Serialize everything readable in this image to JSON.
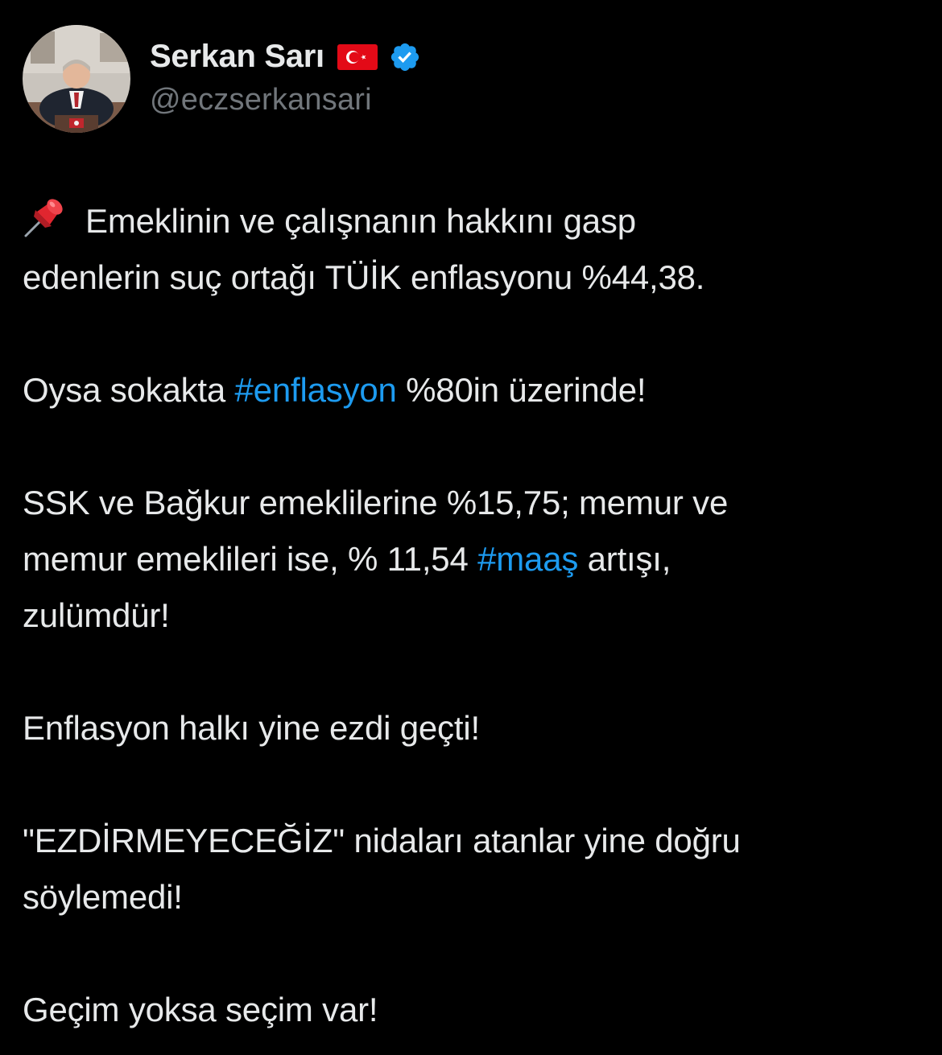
{
  "author": {
    "display_name": "Serkan Sarı",
    "handle": "@eczserkansari",
    "flag_icon": "turkey-flag-icon",
    "verified_icon": "verified-badge-icon",
    "verified_color": "#1d9bf0"
  },
  "tweet": {
    "line1_pin_icon": "pushpin-icon",
    "p1_part1": "Emeklinin ve çalışnanın hakkını gasp",
    "p1_part2": "edenlerin suç ortağı TÜİK enflasyonu %44,38.",
    "p2_before": "Oysa sokakta ",
    "p2_hashtag": "#enflasyon",
    "p2_after": " %80in üzerinde!",
    "p3_line1": "SSK ve Bağkur emeklilerine %15,75; memur ve",
    "p3_line2_before": "memur emeklileri ise, % 11,54 ",
    "p3_hashtag": "#maaş",
    "p3_line2_after": " artışı,",
    "p3_line3": "zulümdür!",
    "p4": "Enflasyon halkı yine ezdi geçti!",
    "p5_line1": "\"EZDİRMEYECEĞİZ\" nidaları atanlar yine doğru",
    "p5_line2": "söylemedi!",
    "p6": "Geçim yoksa seçim var!"
  },
  "colors": {
    "background": "#000000",
    "text": "#e7e9ea",
    "secondary_text": "#71767b",
    "hashtag": "#1d9bf0"
  }
}
